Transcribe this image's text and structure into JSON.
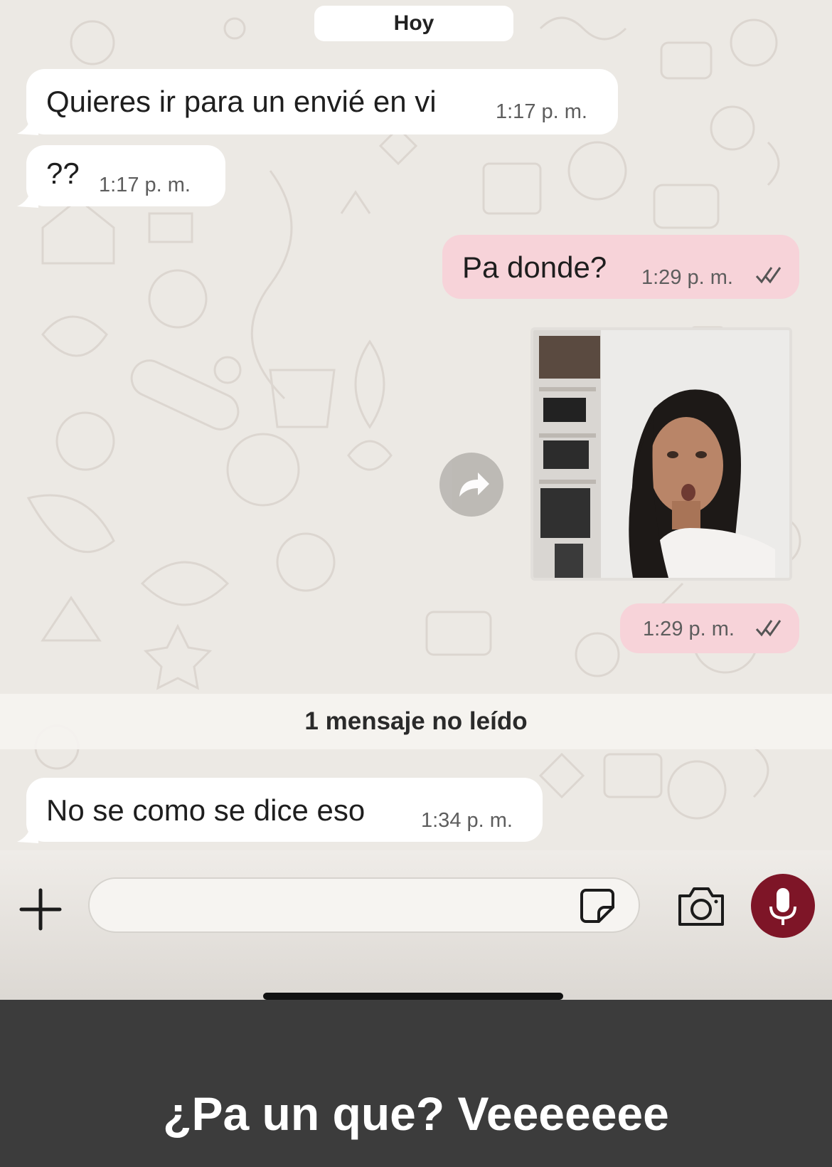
{
  "chat": {
    "date_label": "Hoy",
    "messages": [
      {
        "direction": "incoming",
        "text": "Quieres ir para un envié en vi",
        "time": "1:17 p. m."
      },
      {
        "direction": "incoming",
        "text": "??",
        "time": "1:17 p. m."
      },
      {
        "direction": "outgoing",
        "text": "Pa donde?",
        "time": "1:29 p. m.",
        "status": "read"
      },
      {
        "direction": "outgoing",
        "type": "image",
        "time": "1:29 p. m.",
        "status": "read"
      },
      {
        "direction": "incoming",
        "text": "No se como se dice eso",
        "time": "1:34 p. m."
      }
    ],
    "unread_label": "1 mensaje no leído"
  },
  "composer": {
    "icons": [
      "plus-icon",
      "sticker-icon",
      "camera-icon",
      "microphone-icon"
    ]
  },
  "caption": "¿Pa un que? Veeeeeee",
  "colors": {
    "incoming_bubble": "#ffffff",
    "outgoing_bubble": "#f7d3d9",
    "mic_button": "#7e1527",
    "caption_panel": "#3c3c3c"
  }
}
